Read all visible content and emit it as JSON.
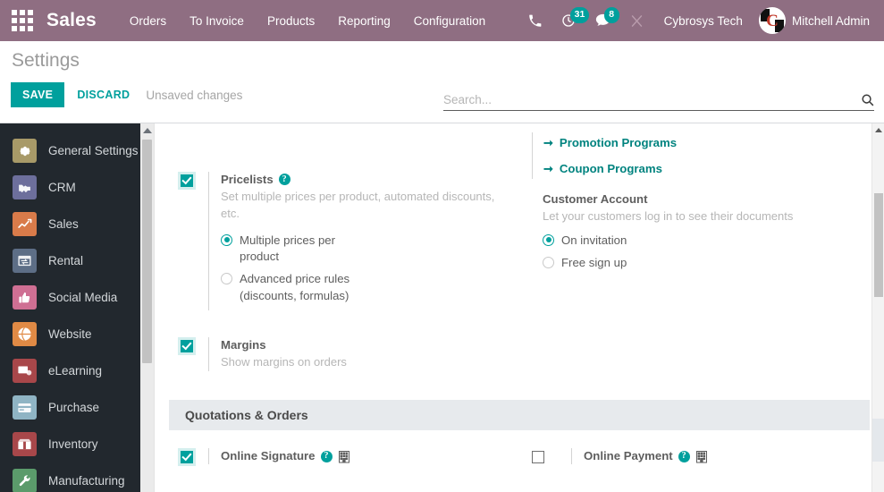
{
  "navbar": {
    "apps_icon": "apps-grid-icon",
    "brand": "Sales",
    "menu": [
      {
        "label": "Orders"
      },
      {
        "label": "To Invoice"
      },
      {
        "label": "Products"
      },
      {
        "label": "Reporting"
      },
      {
        "label": "Configuration"
      }
    ],
    "sys_icons": [
      {
        "name": "phone-icon",
        "badge": null
      },
      {
        "name": "activity-clock-icon",
        "badge": "31"
      },
      {
        "name": "messages-icon",
        "badge": "8"
      },
      {
        "name": "debug-tools-icon",
        "badge": null
      }
    ],
    "company": "Cybrosys Tech",
    "user": "Mitchell Admin",
    "avatar_letter": "C",
    "bg_color": "#8f6e82"
  },
  "control_panel": {
    "title": "Settings",
    "save_label": "SAVE",
    "discard_label": "DISCARD",
    "unsaved_label": "Unsaved changes",
    "accent_color": "#00a09d"
  },
  "search": {
    "placeholder": "Search...",
    "value": "",
    "icon": "search-icon"
  },
  "sidebar": {
    "items": [
      {
        "label": "General Settings",
        "icon": "gear-icon",
        "color": "#a89a68"
      },
      {
        "label": "CRM",
        "icon": "handshake-icon",
        "color": "#6d6f9c"
      },
      {
        "label": "Sales",
        "icon": "chart-line-icon",
        "color": "#d97b4a"
      },
      {
        "label": "Rental",
        "icon": "calendar-exchange-icon",
        "color": "#5d6e86"
      },
      {
        "label": "Social Media",
        "icon": "thumbs-up-icon",
        "color": "#cf6f93"
      },
      {
        "label": "Website",
        "icon": "globe-icon",
        "color": "#e08a45"
      },
      {
        "label": "eLearning",
        "icon": "presentation-icon",
        "color": "#a8474a"
      },
      {
        "label": "Purchase",
        "icon": "card-icon",
        "color": "#8fb4c4"
      },
      {
        "label": "Inventory",
        "icon": "box-icon",
        "color": "#a8474a"
      },
      {
        "label": "Manufacturing",
        "icon": "wrench-icon",
        "color": "#5b9b6b"
      }
    ]
  },
  "settings": {
    "left_column": [
      {
        "id": "pricelists",
        "title": "Pricelists",
        "checked": true,
        "has_help": true,
        "has_company": false,
        "description": "Set multiple prices per product, automated discounts, etc.",
        "radios": [
          {
            "label": "Multiple prices per product",
            "selected": true
          },
          {
            "label": "Advanced price rules (discounts, formulas)",
            "selected": false
          }
        ]
      },
      {
        "id": "margins",
        "title": "Margins",
        "checked": true,
        "has_help": false,
        "has_company": false,
        "description": "Show margins on orders",
        "radios": []
      }
    ],
    "right_column": {
      "links": [
        {
          "label": "Promotion Programs",
          "icon": "arrow-right-icon"
        },
        {
          "label": "Coupon Programs",
          "icon": "arrow-right-icon"
        }
      ],
      "customer_account": {
        "title": "Customer Account",
        "description": "Let your customers log in to see their documents",
        "radios": [
          {
            "label": "On invitation",
            "selected": true
          },
          {
            "label": "Free sign up",
            "selected": false
          }
        ]
      }
    },
    "section": {
      "title": "Quotations & Orders",
      "items": [
        {
          "id": "online-signature",
          "title": "Online Signature",
          "checked": true,
          "has_help": true,
          "has_company": true
        },
        {
          "id": "online-payment",
          "title": "Online Payment",
          "checked": false,
          "has_help": true,
          "has_company": true
        }
      ]
    }
  }
}
